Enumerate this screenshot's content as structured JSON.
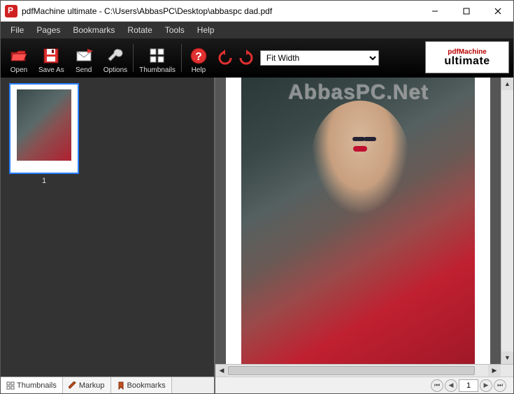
{
  "window": {
    "title": "pdfMachine ultimate - C:\\Users\\AbbasPC\\Desktop\\abbaspc dad.pdf"
  },
  "menu": {
    "file": "File",
    "pages": "Pages",
    "bookmarks": "Bookmarks",
    "rotate": "Rotate",
    "tools": "Tools",
    "help": "Help"
  },
  "toolbar": {
    "open": "Open",
    "save_as": "Save As",
    "send": "Send",
    "options": "Options",
    "thumbnails": "Thumbnails",
    "help": "Help",
    "zoom_selected": "Fit Width"
  },
  "brand": {
    "line1": "pdfMachine",
    "line2": "ultimate"
  },
  "sidebar": {
    "tabs": {
      "thumbnails": "Thumbnails",
      "markup": "Markup",
      "bookmarks": "Bookmarks"
    },
    "thumb_label": "1"
  },
  "viewer": {
    "watermark": "AbbasPC.Net"
  },
  "pager": {
    "current": "1"
  }
}
